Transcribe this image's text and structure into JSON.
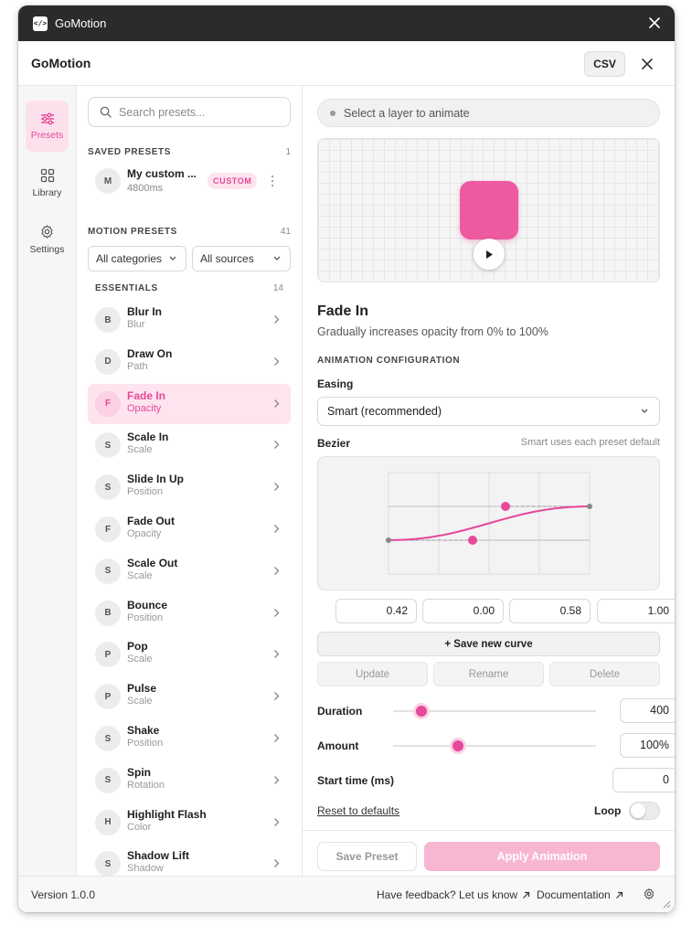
{
  "window": {
    "title": "GoMotion"
  },
  "header": {
    "app_name": "GoMotion",
    "csv_label": "CSV"
  },
  "rail": [
    {
      "label": "Presets",
      "icon": "sliders-icon",
      "active": true
    },
    {
      "label": "Library",
      "icon": "grid-icon",
      "active": false
    },
    {
      "label": "Settings",
      "icon": "gear-icon",
      "active": false
    }
  ],
  "search": {
    "placeholder": "Search presets..."
  },
  "saved": {
    "title": "SAVED PRESETS",
    "count": "1",
    "items": [
      {
        "initial": "M",
        "name": "My custom ...",
        "sub": "4800ms",
        "badge": "CUSTOM"
      }
    ]
  },
  "motion": {
    "title": "MOTION PRESETS",
    "count": "41",
    "category_filter": "All categories",
    "source_filter": "All sources"
  },
  "essentials": {
    "title": "ESSENTIALS",
    "count": "14",
    "items": [
      {
        "initial": "B",
        "name": "Blur In",
        "sub": "Blur"
      },
      {
        "initial": "D",
        "name": "Draw On",
        "sub": "Path"
      },
      {
        "initial": "F",
        "name": "Fade In",
        "sub": "Opacity",
        "active": true
      },
      {
        "initial": "S",
        "name": "Scale In",
        "sub": "Scale"
      },
      {
        "initial": "S",
        "name": "Slide In Up",
        "sub": "Position"
      },
      {
        "initial": "F",
        "name": "Fade Out",
        "sub": "Opacity"
      },
      {
        "initial": "S",
        "name": "Scale Out",
        "sub": "Scale"
      },
      {
        "initial": "B",
        "name": "Bounce",
        "sub": "Position"
      },
      {
        "initial": "P",
        "name": "Pop",
        "sub": "Scale"
      },
      {
        "initial": "P",
        "name": "Pulse",
        "sub": "Scale"
      },
      {
        "initial": "S",
        "name": "Shake",
        "sub": "Position"
      },
      {
        "initial": "S",
        "name": "Spin",
        "sub": "Rotation"
      },
      {
        "initial": "H",
        "name": "Highlight Flash",
        "sub": "Color"
      },
      {
        "initial": "S",
        "name": "Shadow Lift",
        "sub": "Shadow"
      }
    ]
  },
  "panel": {
    "layer_hint": "Select a layer to animate",
    "anim_title": "Fade In",
    "anim_desc": "Gradually increases opacity from 0% to 100%",
    "config_title": "ANIMATION CONFIGURATION",
    "easing_label": "Easing",
    "easing_value": "Smart (recommended)",
    "bezier_label": "Bezier",
    "bezier_hint": "Smart uses each preset default",
    "bezier": [
      "0.42",
      "0.00",
      "0.58",
      "1.00"
    ],
    "save_curve": "+ Save new curve",
    "update": "Update",
    "rename": "Rename",
    "delete": "Delete",
    "duration_label": "Duration",
    "duration_value": "400",
    "duration_fraction": 0.14,
    "amount_label": "Amount",
    "amount_value": "100%",
    "amount_fraction": 0.32,
    "start_label": "Start time (ms)",
    "start_value": "0",
    "reset": "Reset to defaults",
    "loop": "Loop",
    "loop_on": false,
    "save_preset": "Save Preset",
    "apply": "Apply Animation"
  },
  "footer": {
    "version": "Version 1.0.0",
    "feedback": "Have feedback? Let us know",
    "docs": "Documentation"
  },
  "colors": {
    "accent": "#e6489a",
    "accent_soft": "#fde4ee",
    "titlebar": "#2b2b2b"
  }
}
